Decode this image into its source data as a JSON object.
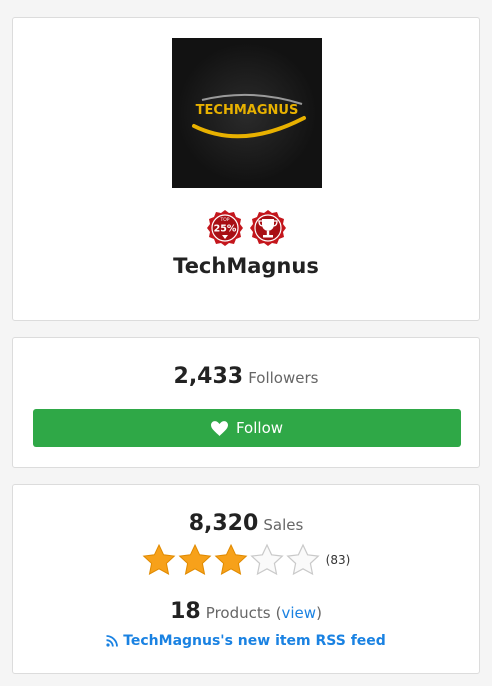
{
  "profile": {
    "logo_text": "TECHMAGNUS",
    "badge_top_label": "TOP",
    "badge_top_value": "25%",
    "store_name": "TechMagnus"
  },
  "followers": {
    "count": "2,433",
    "label": "Followers",
    "follow_label": "Follow"
  },
  "stats": {
    "sales_count": "8,320",
    "sales_label": "Sales",
    "rating": 3,
    "rating_max": 5,
    "rating_count": "(83)",
    "products_count": "18",
    "products_label": "Products",
    "view_open": "(",
    "view_label": "view",
    "view_close": ")",
    "rss_label": "TechMagnus's new item RSS feed"
  },
  "colors": {
    "follow_green": "#2fa847",
    "link_blue": "#1a82e2",
    "badge_red": "#c4161c",
    "star_orange": "#f7a11a"
  },
  "icons": [
    "trophy-icon",
    "heart-icon",
    "star-icon",
    "rss-icon"
  ]
}
